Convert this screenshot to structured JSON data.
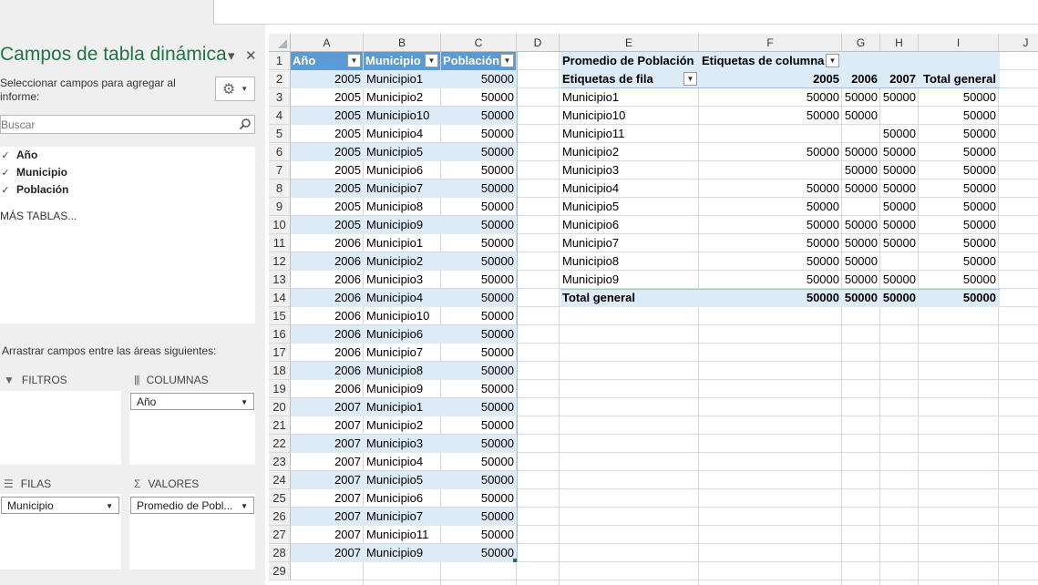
{
  "pivot_pane": {
    "title": "Campos de tabla dinámica",
    "dropdown_glyph": "▾",
    "close_glyph": "✕",
    "description": "Seleccionar campos para agregar al informe:",
    "search_placeholder": "Buscar",
    "fields": [
      {
        "label": "Año",
        "checked": true
      },
      {
        "label": "Municipio",
        "checked": true
      },
      {
        "label": "Población",
        "checked": true
      }
    ],
    "more_tables": "MÁS TABLAS...",
    "drag_label": "Arrastrar campos entre las áreas siguientes:",
    "areas": {
      "filters": {
        "label": "FILTROS",
        "items": []
      },
      "columns": {
        "label": "COLUMNAS",
        "items": [
          "Año"
        ]
      },
      "rows": {
        "label": "FILAS",
        "items": [
          "Municipio"
        ]
      },
      "values": {
        "label": "VALORES",
        "items": [
          "Promedio de Pobl..."
        ]
      }
    }
  },
  "sheet": {
    "columns": [
      "A",
      "B",
      "C",
      "D",
      "E",
      "F",
      "G",
      "H",
      "I",
      "J"
    ],
    "row_numbers": [
      "1",
      "2",
      "3",
      "4",
      "5",
      "6",
      "7",
      "8",
      "9",
      "10",
      "11",
      "12",
      "13",
      "14",
      "15",
      "16",
      "17",
      "18",
      "19",
      "20",
      "21",
      "22",
      "23",
      "24",
      "25",
      "26",
      "27",
      "28",
      "29"
    ],
    "table": {
      "headers": [
        "Año",
        "Municipio",
        "Población"
      ],
      "rows": [
        [
          "2005",
          "Municipio1",
          "50000"
        ],
        [
          "2005",
          "Municipio2",
          "50000"
        ],
        [
          "2005",
          "Municipio10",
          "50000"
        ],
        [
          "2005",
          "Municipio4",
          "50000"
        ],
        [
          "2005",
          "Municipio5",
          "50000"
        ],
        [
          "2005",
          "Municipio6",
          "50000"
        ],
        [
          "2005",
          "Municipio7",
          "50000"
        ],
        [
          "2005",
          "Municipio8",
          "50000"
        ],
        [
          "2005",
          "Municipio9",
          "50000"
        ],
        [
          "2006",
          "Municipio1",
          "50000"
        ],
        [
          "2006",
          "Municipio2",
          "50000"
        ],
        [
          "2006",
          "Municipio3",
          "50000"
        ],
        [
          "2006",
          "Municipio4",
          "50000"
        ],
        [
          "2006",
          "Municipio10",
          "50000"
        ],
        [
          "2006",
          "Municipio6",
          "50000"
        ],
        [
          "2006",
          "Municipio7",
          "50000"
        ],
        [
          "2006",
          "Municipio8",
          "50000"
        ],
        [
          "2006",
          "Municipio9",
          "50000"
        ],
        [
          "2007",
          "Municipio1",
          "50000"
        ],
        [
          "2007",
          "Municipio2",
          "50000"
        ],
        [
          "2007",
          "Municipio3",
          "50000"
        ],
        [
          "2007",
          "Municipio4",
          "50000"
        ],
        [
          "2007",
          "Municipio5",
          "50000"
        ],
        [
          "2007",
          "Municipio6",
          "50000"
        ],
        [
          "2007",
          "Municipio7",
          "50000"
        ],
        [
          "2007",
          "Municipio11",
          "50000"
        ],
        [
          "2007",
          "Municipio9",
          "50000"
        ]
      ]
    },
    "pivot": {
      "title": "Promedio de Población",
      "col_labels": "Etiquetas de columna",
      "row_labels": "Etiquetas de fila",
      "years": [
        "2005",
        "2006",
        "2007"
      ],
      "total_header": "Total general",
      "rows": [
        {
          "label": "Municipio1",
          "values": [
            "50000",
            "50000",
            "50000"
          ],
          "total": "50000"
        },
        {
          "label": "Municipio10",
          "values": [
            "50000",
            "50000",
            ""
          ],
          "total": "50000"
        },
        {
          "label": "Municipio11",
          "values": [
            "",
            "",
            "50000"
          ],
          "total": "50000"
        },
        {
          "label": "Municipio2",
          "values": [
            "50000",
            "50000",
            "50000"
          ],
          "total": "50000"
        },
        {
          "label": "Municipio3",
          "values": [
            "",
            "50000",
            "50000"
          ],
          "total": "50000"
        },
        {
          "label": "Municipio4",
          "values": [
            "50000",
            "50000",
            "50000"
          ],
          "total": "50000"
        },
        {
          "label": "Municipio5",
          "values": [
            "50000",
            "",
            "50000"
          ],
          "total": "50000"
        },
        {
          "label": "Municipio6",
          "values": [
            "50000",
            "50000",
            "50000"
          ],
          "total": "50000"
        },
        {
          "label": "Municipio7",
          "values": [
            "50000",
            "50000",
            "50000"
          ],
          "total": "50000"
        },
        {
          "label": "Municipio8",
          "values": [
            "50000",
            "50000",
            ""
          ],
          "total": "50000"
        },
        {
          "label": "Municipio9",
          "values": [
            "50000",
            "50000",
            "50000"
          ],
          "total": "50000"
        }
      ],
      "grand_total": {
        "label": "Total general",
        "values": [
          "50000",
          "50000",
          "50000"
        ],
        "total": "50000"
      }
    }
  },
  "colors": {
    "accent": "#217346",
    "table_header": "#5b9bd5",
    "band": "#ddebf7"
  }
}
